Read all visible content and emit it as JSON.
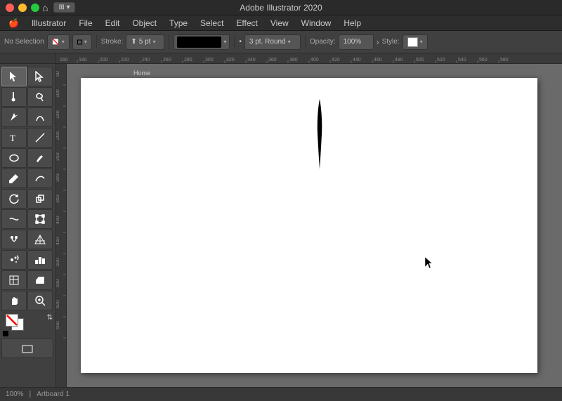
{
  "titlebar": {
    "title": "Adobe Illustrator 2020",
    "app_name": "Illustrator"
  },
  "menubar": {
    "items": [
      {
        "label": "File",
        "id": "menu-file"
      },
      {
        "label": "Edit",
        "id": "menu-edit"
      },
      {
        "label": "Object",
        "id": "menu-object"
      },
      {
        "label": "Type",
        "id": "menu-type"
      },
      {
        "label": "Select",
        "id": "menu-select"
      },
      {
        "label": "Effect",
        "id": "menu-effect"
      },
      {
        "label": "View",
        "id": "menu-view"
      },
      {
        "label": "Window",
        "id": "menu-window"
      },
      {
        "label": "Help",
        "id": "menu-help"
      }
    ]
  },
  "toolbar": {
    "selection_label": "No Selection",
    "stroke_label": "Stroke:",
    "stroke_value": "5 pt",
    "brush_label": "3 pt. Round",
    "opacity_label": "Opacity:",
    "opacity_value": "100%",
    "style_label": "Style:"
  },
  "tools": [
    {
      "name": "selection-tool",
      "icon": "▶",
      "label": "Selection"
    },
    {
      "name": "direct-selection-tool",
      "icon": "▷",
      "label": "Direct Selection"
    },
    {
      "name": "pen-tool",
      "icon": "✒",
      "label": "Pen"
    },
    {
      "name": "add-anchor-tool",
      "icon": "+✒",
      "label": "Add Anchor"
    },
    {
      "name": "type-tool",
      "icon": "T",
      "label": "Type"
    },
    {
      "name": "line-tool",
      "icon": "╲",
      "label": "Line"
    },
    {
      "name": "ellipse-tool",
      "icon": "○",
      "label": "Ellipse"
    },
    {
      "name": "pencil-tool",
      "icon": "✏",
      "label": "Pencil"
    },
    {
      "name": "paintbrush-tool",
      "icon": "🖌",
      "label": "Paintbrush"
    },
    {
      "name": "rotate-tool",
      "icon": "↻",
      "label": "Rotate"
    },
    {
      "name": "scale-tool",
      "icon": "⤢",
      "label": "Scale"
    },
    {
      "name": "warp-tool",
      "icon": "≈",
      "label": "Warp"
    },
    {
      "name": "free-transform-tool",
      "icon": "⊡",
      "label": "Free Transform"
    },
    {
      "name": "perspective-tool",
      "icon": "⬡",
      "label": "Perspective"
    },
    {
      "name": "symbol-sprayer",
      "icon": "⊛",
      "label": "Symbol Sprayer"
    },
    {
      "name": "column-graph-tool",
      "icon": "▐▌",
      "label": "Column Graph"
    },
    {
      "name": "slice-tool",
      "icon": "⊠",
      "label": "Slice"
    },
    {
      "name": "hand-tool",
      "icon": "✋",
      "label": "Hand"
    },
    {
      "name": "zoom-tool",
      "icon": "🔍",
      "label": "Zoom"
    },
    {
      "name": "fill-color",
      "icon": "fill",
      "label": "Fill Color"
    },
    {
      "name": "change-screen-mode",
      "icon": "⬜",
      "label": "Change Screen Mode"
    }
  ],
  "statusbar": {
    "zoom": "100%",
    "artboard": "Artboard 1"
  }
}
